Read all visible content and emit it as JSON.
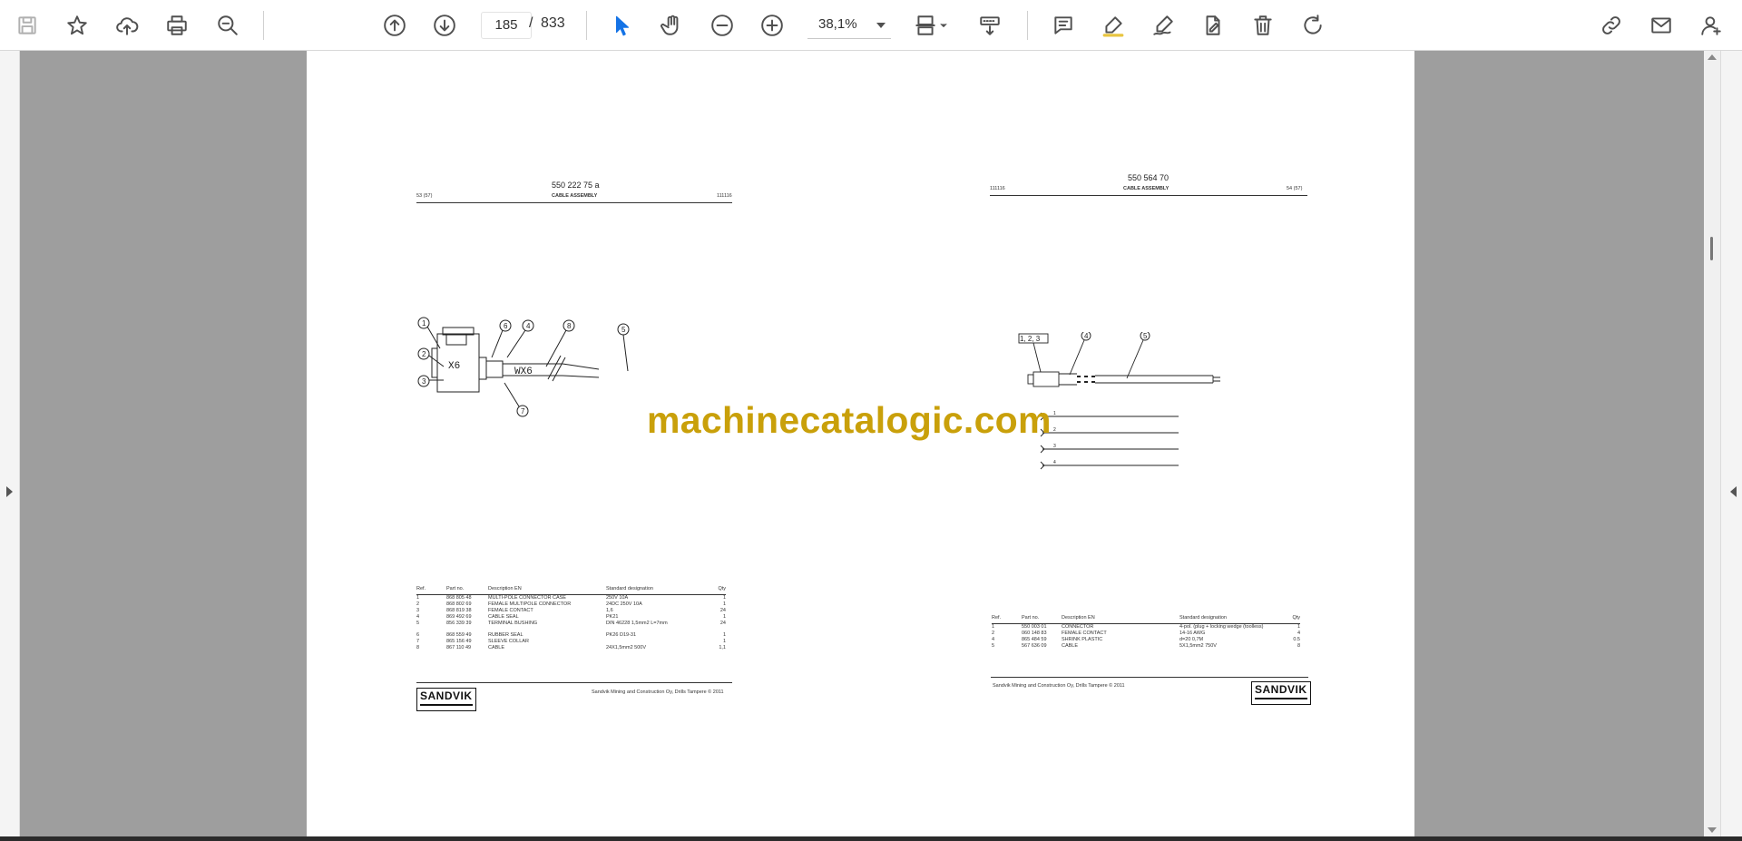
{
  "toolbar": {
    "page": {
      "current": "185",
      "separator": "/",
      "total": "833"
    },
    "zoom": "38,1%",
    "icons": [
      "save-icon",
      "bookmark-star-icon",
      "cloud-upload-icon",
      "print-icon",
      "find-zoom-icon",
      "previous-page-icon",
      "next-page-icon",
      "select-cursor-icon",
      "hand-pan-icon",
      "zoom-out-icon",
      "zoom-in-icon",
      "page-fit-icon",
      "scroll-mode-icon",
      "comment-icon",
      "highlight-icon",
      "sign-icon",
      "edit-pdf-icon",
      "delete-icon",
      "rotate-icon",
      "share-link-icon",
      "email-icon",
      "account-icon"
    ],
    "accent_color": "#1473e6"
  },
  "watermark": "machinecatalogic.com",
  "left_page": {
    "doc_number": "550 222 75 a",
    "page_ref": "53 (57)",
    "title": "CABLE ASSEMBLY",
    "date_code": "111116",
    "diagram": {
      "housing_label": "X6",
      "cable_label": "WX6",
      "callouts": [
        "1",
        "2",
        "3",
        "6",
        "4",
        "8",
        "5",
        "7"
      ]
    },
    "table": {
      "headers": [
        "Ref.",
        "Part no.",
        "Description EN",
        "Standard designation",
        "Qty"
      ],
      "rows": [
        [
          "1",
          "868 805 48",
          "MULTI-POLE CONNECTOR CASE",
          "250V 10A",
          "1"
        ],
        [
          "2",
          "868 802 69",
          "FEMALE MULTIPOLE CONNECTOR",
          "24DC 250V 10A",
          "1"
        ],
        [
          "3",
          "868 819 38",
          "FEMALE CONTACT",
          "1,6",
          "24"
        ],
        [
          "4",
          "869 492 69",
          "CABLE SEAL",
          "PK21",
          "1"
        ],
        [
          "5",
          "856 339 39",
          "TERMINAL BUSHING",
          "DIN 46228 1,5mm2 L=7mm",
          "24"
        ],
        [
          "6",
          "868 559 49",
          "RUBBER SEAL",
          "PK26 D19-31",
          "1"
        ],
        [
          "7",
          "865 156 49",
          "SLEEVE COLLAR",
          "",
          "1"
        ],
        [
          "8",
          "867 110 49",
          "CABLE",
          "24X1,5mm2 500V",
          "1,1"
        ]
      ]
    },
    "footer": "Sandvik Mining and Construction Oy, Drills Tampere © 2011",
    "logo": "SANDVIK"
  },
  "right_page": {
    "doc_number": "550 564 70",
    "page_ref": "54 (57)",
    "title": "CABLE ASSEMBLY",
    "date_code": "111116",
    "diagram": {
      "callouts": [
        "1, 2, 3",
        "4",
        "5"
      ],
      "pin_labels": [
        "1",
        "2",
        "3",
        "4"
      ]
    },
    "table": {
      "headers": [
        "Ref.",
        "Part no.",
        "Description EN",
        "Standard designation",
        "Qty"
      ],
      "rows": [
        [
          "1",
          "550 003 01",
          "CONNECTOR",
          "4-pol. (plug + locking wedge (toolless)",
          "1"
        ],
        [
          "2",
          "060 148 83",
          "FEMALE CONTACT",
          "14-16 AWG",
          "4"
        ],
        [
          "4",
          "865 484 59",
          "SHRINK PLASTIC",
          "d=20 0,7M",
          "0.5"
        ],
        [
          "5",
          "567 636 09",
          "CABLE",
          "5X1,5mm2 750V",
          "8"
        ]
      ]
    },
    "footer": "Sandvik Mining and Construction Oy, Drills Tampere © 2011",
    "logo": "SANDVIK"
  }
}
